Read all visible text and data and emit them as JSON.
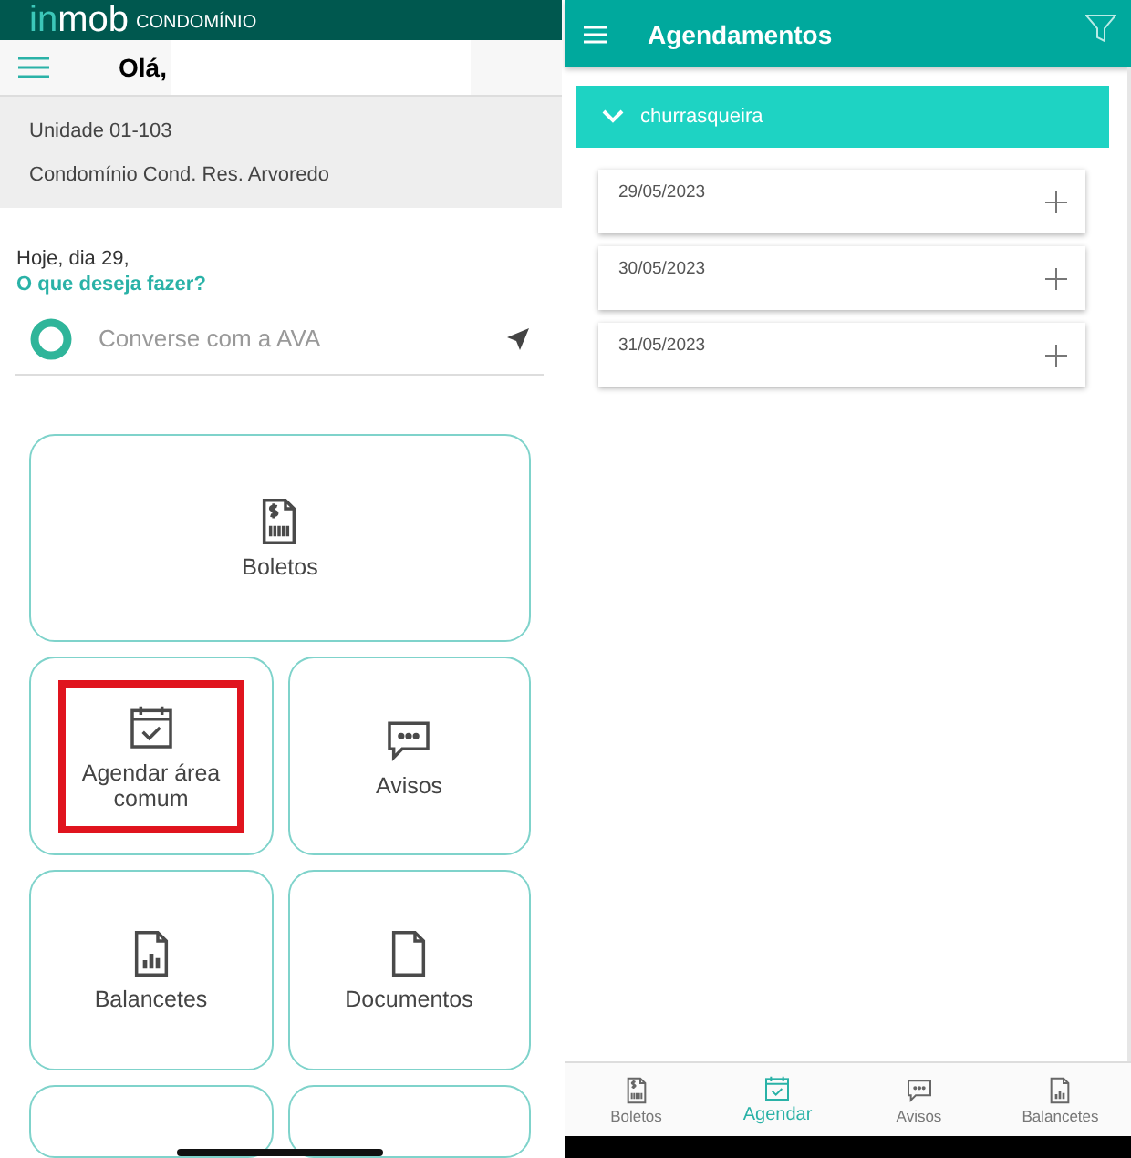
{
  "home": {
    "logo": {
      "prefix": "in",
      "name": "mob",
      "suffix": "CONDOMÍNIO"
    },
    "greeting": "Olá,",
    "unit": "Unidade 01-103",
    "condo": "Condomínio Cond. Res. Arvoredo",
    "today": "Hoje, dia 29,",
    "prompt": "O que deseja fazer?",
    "chat": {
      "placeholder": "Converse com a AVA"
    },
    "tiles": [
      {
        "kind": "boleto",
        "label": "Boletos",
        "highlighted": false
      },
      {
        "kind": "calendar",
        "label": "Agendar área comum",
        "highlighted": true
      },
      {
        "kind": "chat",
        "label": "Avisos",
        "highlighted": false
      },
      {
        "kind": "chart",
        "label": "Balancetes",
        "highlighted": false
      },
      {
        "kind": "document",
        "label": "Documentos",
        "highlighted": false
      }
    ]
  },
  "schedule": {
    "title": "Agendamentos",
    "section": {
      "label": "churrasqueira",
      "expanded": true
    },
    "dates": [
      "29/05/2023",
      "30/05/2023",
      "31/05/2023"
    ],
    "nav": [
      {
        "kind": "boleto",
        "label": "Boletos",
        "selected": false
      },
      {
        "kind": "calendar",
        "label": "Agendar",
        "selected": true
      },
      {
        "kind": "chat",
        "label": "Avisos",
        "selected": false
      },
      {
        "kind": "chart",
        "label": "Balancetes",
        "selected": false
      }
    ]
  }
}
